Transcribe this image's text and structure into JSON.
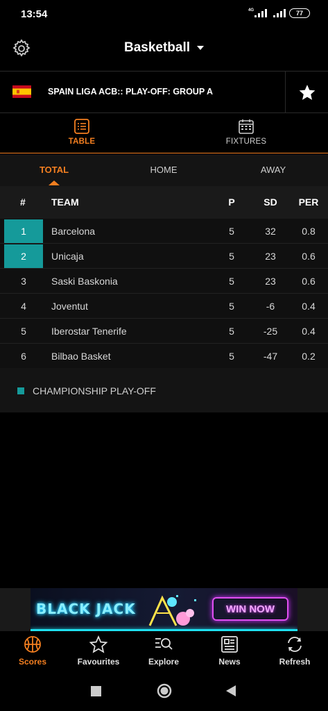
{
  "status_bar": {
    "time": "13:54",
    "network": "4G",
    "battery": "77"
  },
  "header": {
    "sport_title": "Basketball"
  },
  "league": {
    "name": "SPAIN LIGA ACB:: PLAY-OFF: GROUP A"
  },
  "main_tabs": [
    {
      "label": "TABLE",
      "active": true,
      "icon": "list-icon"
    },
    {
      "label": "FIXTURES",
      "active": false,
      "icon": "calendar-icon"
    }
  ],
  "sub_tabs": [
    {
      "label": "TOTAL",
      "active": true
    },
    {
      "label": "HOME",
      "active": false
    },
    {
      "label": "AWAY",
      "active": false
    }
  ],
  "table": {
    "columns": {
      "pos": "#",
      "team": "TEAM",
      "p": "P",
      "sd": "SD",
      "per": "PER"
    },
    "rows": [
      {
        "pos": "1",
        "team": "Barcelona",
        "p": "5",
        "sd": "32",
        "per": "0.8",
        "qualified": true
      },
      {
        "pos": "2",
        "team": "Unicaja",
        "p": "5",
        "sd": "23",
        "per": "0.6",
        "qualified": true
      },
      {
        "pos": "3",
        "team": "Saski Baskonia",
        "p": "5",
        "sd": "23",
        "per": "0.6",
        "qualified": false
      },
      {
        "pos": "4",
        "team": "Joventut",
        "p": "5",
        "sd": "-6",
        "per": "0.4",
        "qualified": false
      },
      {
        "pos": "5",
        "team": "Iberostar Tenerife",
        "p": "5",
        "sd": "-25",
        "per": "0.4",
        "qualified": false
      },
      {
        "pos": "6",
        "team": "Bilbao Basket",
        "p": "5",
        "sd": "-47",
        "per": "0.2",
        "qualified": false
      }
    ]
  },
  "legend": {
    "label": "CHAMPIONSHIP PLAY-OFF",
    "color": "#159a9a"
  },
  "ad": {
    "left_text": "BLACK JACK",
    "button_text": "WIN NOW"
  },
  "bottom_nav": [
    {
      "label": "Scores",
      "icon": "basketball-icon",
      "active": true
    },
    {
      "label": "Favourites",
      "icon": "star-outline-icon",
      "active": false
    },
    {
      "label": "Explore",
      "icon": "explore-icon",
      "active": false
    },
    {
      "label": "News",
      "icon": "news-icon",
      "active": false
    },
    {
      "label": "Refresh",
      "icon": "refresh-icon",
      "active": false
    }
  ],
  "colors": {
    "accent": "#f47f20",
    "qualified": "#159a9a",
    "background": "#000000"
  }
}
